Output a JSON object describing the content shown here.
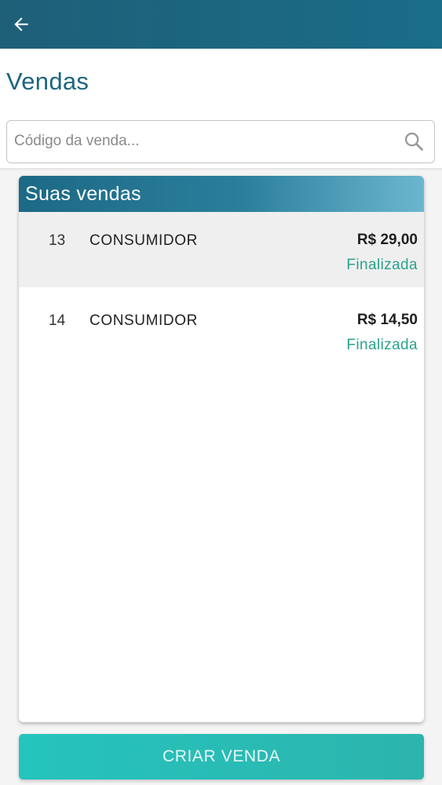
{
  "appbar": {
    "back_icon": "arrow-left-icon"
  },
  "header": {
    "title": "Vendas"
  },
  "search": {
    "placeholder": "Código da venda...",
    "value": "",
    "icon": "search-icon"
  },
  "sales_card": {
    "title": "Suas vendas",
    "rows": [
      {
        "id": "13",
        "client": "CONSUMIDOR",
        "value": "R$ 29,00",
        "status": "Finalizada",
        "selected": true
      },
      {
        "id": "14",
        "client": "CONSUMIDOR",
        "value": "R$ 14,50",
        "status": "Finalizada",
        "selected": false
      }
    ]
  },
  "actions": {
    "create_label": "CRIAR VENDA"
  },
  "colors": {
    "appbar": "#1e5f78",
    "title": "#1c6580",
    "status": "#2aa38b",
    "button": "#25c4bc"
  }
}
